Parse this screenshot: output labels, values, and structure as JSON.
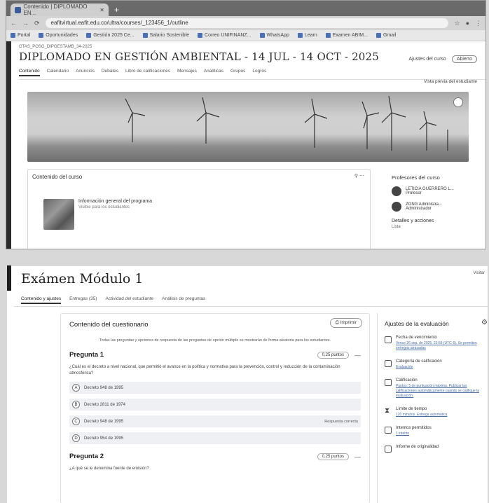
{
  "browser": {
    "tab_title": "Contenido | DIPLOMADO EN...",
    "url": "eafitvirtual.eafit.edu.co/ultra/courses/_123456_1/outline",
    "bookmarks": [
      "Portal",
      "Oportunidades",
      "Gestión 2025 Ce...",
      "Salario Sostenible",
      "Correo UNIFINANZ...",
      "WhatsApp",
      "Learn",
      "Examen ABIM...",
      "Gmail"
    ]
  },
  "course": {
    "crumb": "GTAS_POSG_DIPGESTAMB_34-2025",
    "title": "DIPLOMADO EN GESTIÓN AMBIENTAL - 14 JUL - 14 OCT - 2025",
    "actions": {
      "settings": "Ajustes del curso",
      "status": "Abierto"
    },
    "tabs": [
      "Contenido",
      "Calendario",
      "Anuncios",
      "Debates",
      "Libro de calificaciones",
      "Mensajes",
      "Analíticas",
      "Grupos",
      "Logros"
    ],
    "student_view": "Vista previa del estudiante",
    "content_title": "Contenido del curso",
    "item": {
      "title": "Información general del programa",
      "subtitle": "Visible para los estudiantes"
    },
    "professors_title": "Profesores del curso",
    "professors": [
      "LETICIA GUERRERO L...",
      "ZONG Administra..."
    ],
    "professor_roles": [
      "Profesor",
      "Administrador"
    ],
    "details_title": "Detalles y acciones",
    "details_sub": "Lista"
  },
  "quiz": {
    "title": "Exámen Módulo 1",
    "visit": "Visitar",
    "tabs": [
      "Contenido y ajustes",
      "Entregas (35)",
      "Actividad del estudiante",
      "Análisis de preguntas"
    ],
    "content_title": "Contenido del cuestionario",
    "print": "Imprimir",
    "intro": "Todas las preguntas y opciones de respuesta de las preguntas de opción múltiple se mostrarán de forma aleatoria para los estudiantes.",
    "questions": [
      {
        "label": "Pregunta 1",
        "points": "0,25 puntos",
        "text": "¿Cuál es el decreto a nivel nacional, que permitió el avance en la política y normativa para la prevención, control y reducción de la contaminación atmosférica?",
        "options": [
          {
            "letter": "A",
            "text": "Decreto 948 de 1995",
            "tag": ""
          },
          {
            "letter": "B",
            "text": "Decreto 2811 de 1974",
            "tag": ""
          },
          {
            "letter": "C",
            "text": "Decreto 948 de 1995",
            "tag": "Respuesta correcta"
          },
          {
            "letter": "D",
            "text": "Decreto 954 de 1995",
            "tag": ""
          }
        ]
      },
      {
        "label": "Pregunta 2",
        "points": "0,25 puntos",
        "text": "¿A qué se le denomina fuente de emisión?"
      }
    ],
    "settings_title": "Ajustes de la evaluación",
    "settings": [
      {
        "icon": "calendar-icon",
        "label": "Fecha de vencimiento",
        "value": "Vence 26 sep. de 2025, 23:59 (UTC-5). Se permiten entregas atrasadas"
      },
      {
        "icon": "grade-category-icon",
        "label": "Categoría de calificación",
        "value": "Evaluación"
      },
      {
        "icon": "grading-icon",
        "label": "Calificación",
        "value": "Puntos: 5 de puntuación máxima. Publicar las calificaciones automáticamente cuando se califique la evaluación."
      },
      {
        "icon": "hourglass-icon",
        "label": "Límite de tiempo",
        "value": "120 minutos. Entrega automática"
      },
      {
        "icon": "attempts-icon",
        "label": "Intentos permitidos",
        "value": "1 intento"
      },
      {
        "icon": "originality-icon",
        "label": "Informe de originalidad",
        "value": ""
      }
    ]
  }
}
